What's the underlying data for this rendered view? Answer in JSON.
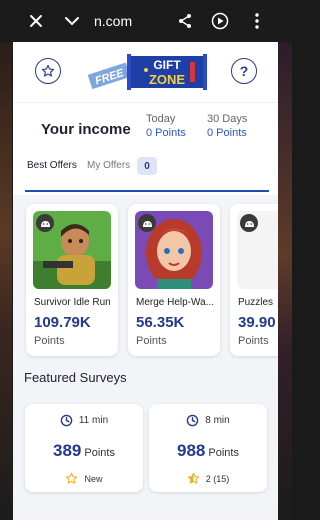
{
  "browser": {
    "url_fragment": "n.com",
    "icons": [
      "close-icon",
      "chevron-down-icon",
      "share-icon",
      "play-icon",
      "more-vert-icon"
    ]
  },
  "header": {
    "left_icon": "star-icon",
    "right_icon": "help-icon",
    "right_label": "?",
    "logo": {
      "word1": "FREE",
      "word2": "GIFT",
      "word3": "ZONE"
    }
  },
  "income": {
    "title": "Your income",
    "today_label": "Today",
    "today_value": "0 Points",
    "days_label": "30 Days",
    "days_value": "0 Points"
  },
  "tabs": {
    "best": "Best Offers",
    "mine": "My Offers",
    "mine_count": "0"
  },
  "offers": [
    {
      "name": "Survivor Idle Run",
      "points": "109.79K",
      "unit": "Points"
    },
    {
      "name": "Merge Help-Wa...",
      "points": "56.35K",
      "unit": "Points"
    },
    {
      "name": "Puzzles",
      "points": "39.90",
      "unit": "Points"
    }
  ],
  "surveys": {
    "title": "Featured Surveys",
    "items": [
      {
        "time": "11 min",
        "points": "389",
        "unit": "Points",
        "rating": "New"
      },
      {
        "time": "8 min",
        "points": "988",
        "unit": "Points",
        "rating": "2 (15)"
      }
    ]
  },
  "colors": {
    "accent": "#2d56c9",
    "dark_blue": "#243a8a",
    "tab_line": "#1e4fa8"
  }
}
